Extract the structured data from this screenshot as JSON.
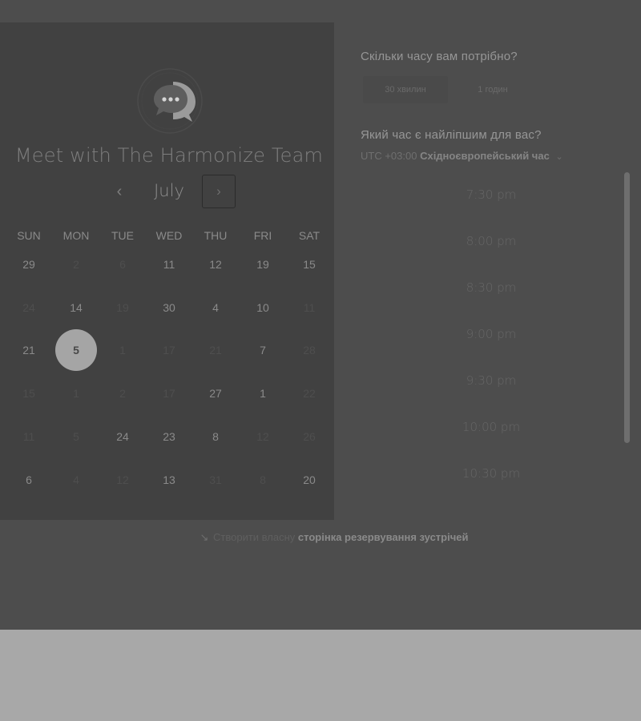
{
  "header": {
    "title": "Meet with The Harmonize Team",
    "logo_icon": "chat-bubble-icon"
  },
  "calendar": {
    "month": "July",
    "prev_label": "‹",
    "next_label": "›",
    "weekdays": [
      "SUN",
      "MON",
      "TUE",
      "WED",
      "THU",
      "FRI",
      "SAT"
    ],
    "weeks": [
      [
        {
          "d": "29",
          "a": true
        },
        {
          "d": "2",
          "a": false
        },
        {
          "d": "6",
          "a": false
        },
        {
          "d": "11",
          "a": true
        },
        {
          "d": "12",
          "a": true
        },
        {
          "d": "19",
          "a": true
        },
        {
          "d": "15",
          "a": true
        }
      ],
      [
        {
          "d": "24",
          "a": false
        },
        {
          "d": "14",
          "a": true
        },
        {
          "d": "19",
          "a": false
        },
        {
          "d": "30",
          "a": true
        },
        {
          "d": "4",
          "a": true
        },
        {
          "d": "10",
          "a": true
        },
        {
          "d": "11",
          "a": false
        }
      ],
      [
        {
          "d": "21",
          "a": true
        },
        {
          "d": "5",
          "a": true,
          "selected": true
        },
        {
          "d": "1",
          "a": false
        },
        {
          "d": "17",
          "a": false
        },
        {
          "d": "21",
          "a": false
        },
        {
          "d": "7",
          "a": true
        },
        {
          "d": "28",
          "a": false
        }
      ],
      [
        {
          "d": "15",
          "a": false
        },
        {
          "d": "1",
          "a": false
        },
        {
          "d": "2",
          "a": false
        },
        {
          "d": "17",
          "a": false
        },
        {
          "d": "27",
          "a": true
        },
        {
          "d": "1",
          "a": true
        },
        {
          "d": "22",
          "a": false
        }
      ],
      [
        {
          "d": "11",
          "a": false
        },
        {
          "d": "5",
          "a": false
        },
        {
          "d": "24",
          "a": true
        },
        {
          "d": "23",
          "a": true
        },
        {
          "d": "8",
          "a": true
        },
        {
          "d": "12",
          "a": false
        },
        {
          "d": "26",
          "a": false
        }
      ],
      [
        {
          "d": "6",
          "a": true
        },
        {
          "d": "4",
          "a": false
        },
        {
          "d": "12",
          "a": false
        },
        {
          "d": "13",
          "a": true
        },
        {
          "d": "31",
          "a": false
        },
        {
          "d": "8",
          "a": false
        },
        {
          "d": "20",
          "a": true
        }
      ]
    ]
  },
  "duration": {
    "heading": "Скільки часу вам потрібно?",
    "options": [
      "30 хвилин",
      "1 годин"
    ],
    "selected_index": 0
  },
  "time": {
    "heading": "Який час є найліпшим для вас?",
    "timezone_offset": "UTC +03:00",
    "timezone_name": "Східноєвропейський час",
    "timezone_caret": "⌄",
    "slots": [
      "7:30 pm",
      "8:00 pm",
      "8:30 pm",
      "9:00 pm",
      "9:30 pm",
      "10:00 pm",
      "10:30 pm"
    ]
  },
  "footer": {
    "arrow": "↘",
    "text_prefix": "Створити власну",
    "text_bold": "сторінка резервування зустрічей"
  }
}
